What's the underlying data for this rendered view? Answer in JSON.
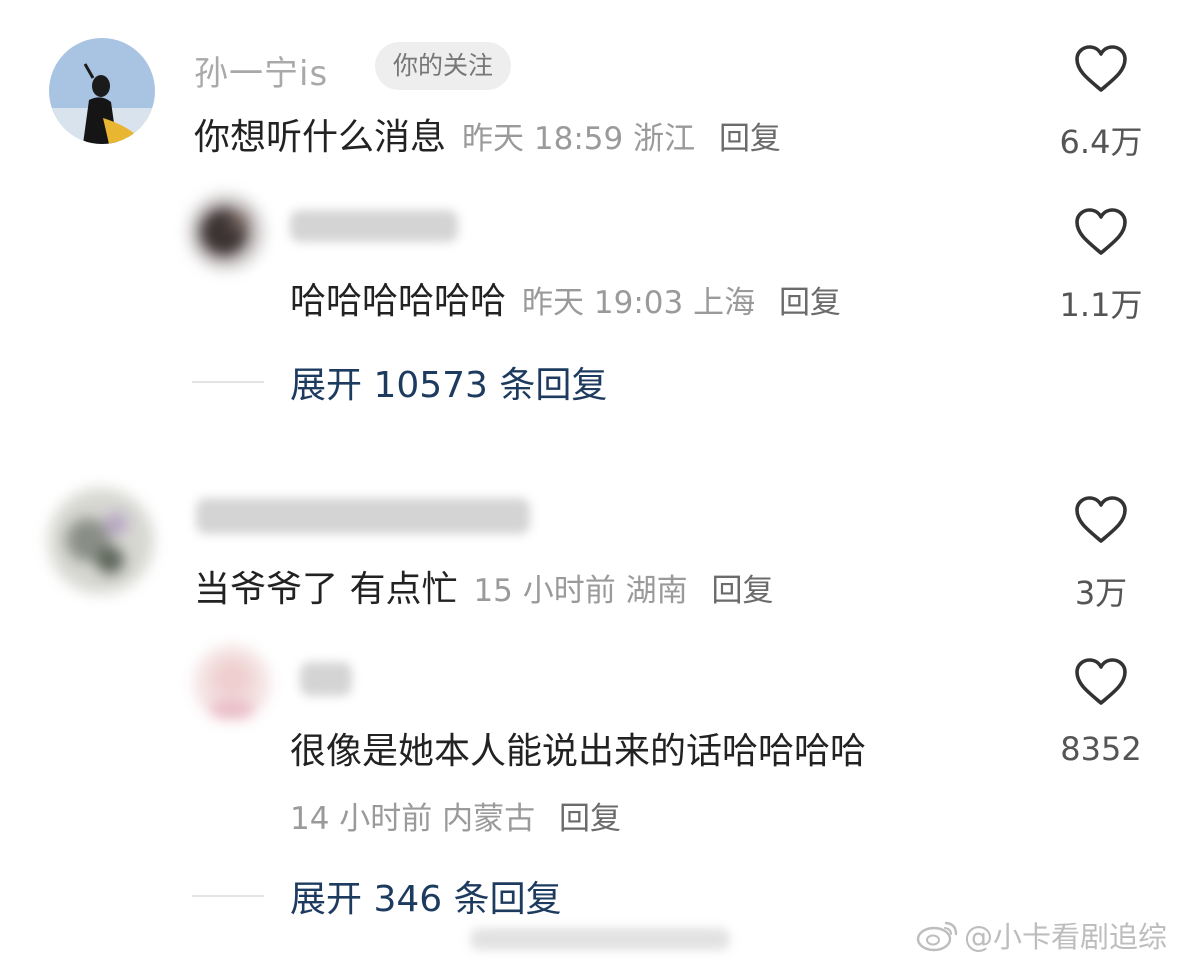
{
  "comments": [
    {
      "username": "孙一宁is",
      "badge": "你的关注",
      "text": "你想听什么消息",
      "time": "昨天 18:59",
      "location": "浙江",
      "reply": "回复",
      "likes": "6.4万",
      "replies": [
        {
          "username": "",
          "text": "哈哈哈哈哈哈",
          "time": "昨天 19:03",
          "location": "上海",
          "reply": "回复",
          "likes": "1.1万"
        }
      ],
      "expand": "展开 10573 条回复"
    },
    {
      "username": "",
      "text": "当爷爷了 有点忙",
      "time": "15 小时前",
      "location": "湖南",
      "reply": "回复",
      "likes": "3万",
      "replies": [
        {
          "username": "",
          "text": "很像是她本人能说出来的话哈哈哈哈",
          "time": "14 小时前",
          "location": "内蒙古",
          "reply": "回复",
          "likes": "8352"
        }
      ],
      "expand": "展开 346 条回复"
    }
  ],
  "watermark": "@小卡看剧追综",
  "colors": {
    "link": "#1d3a5f",
    "meta": "#9a9a9a",
    "text": "#222222",
    "badge_bg": "#eeeeee"
  },
  "icons": [
    "heart-outline-icon",
    "weibo-logo-icon"
  ]
}
